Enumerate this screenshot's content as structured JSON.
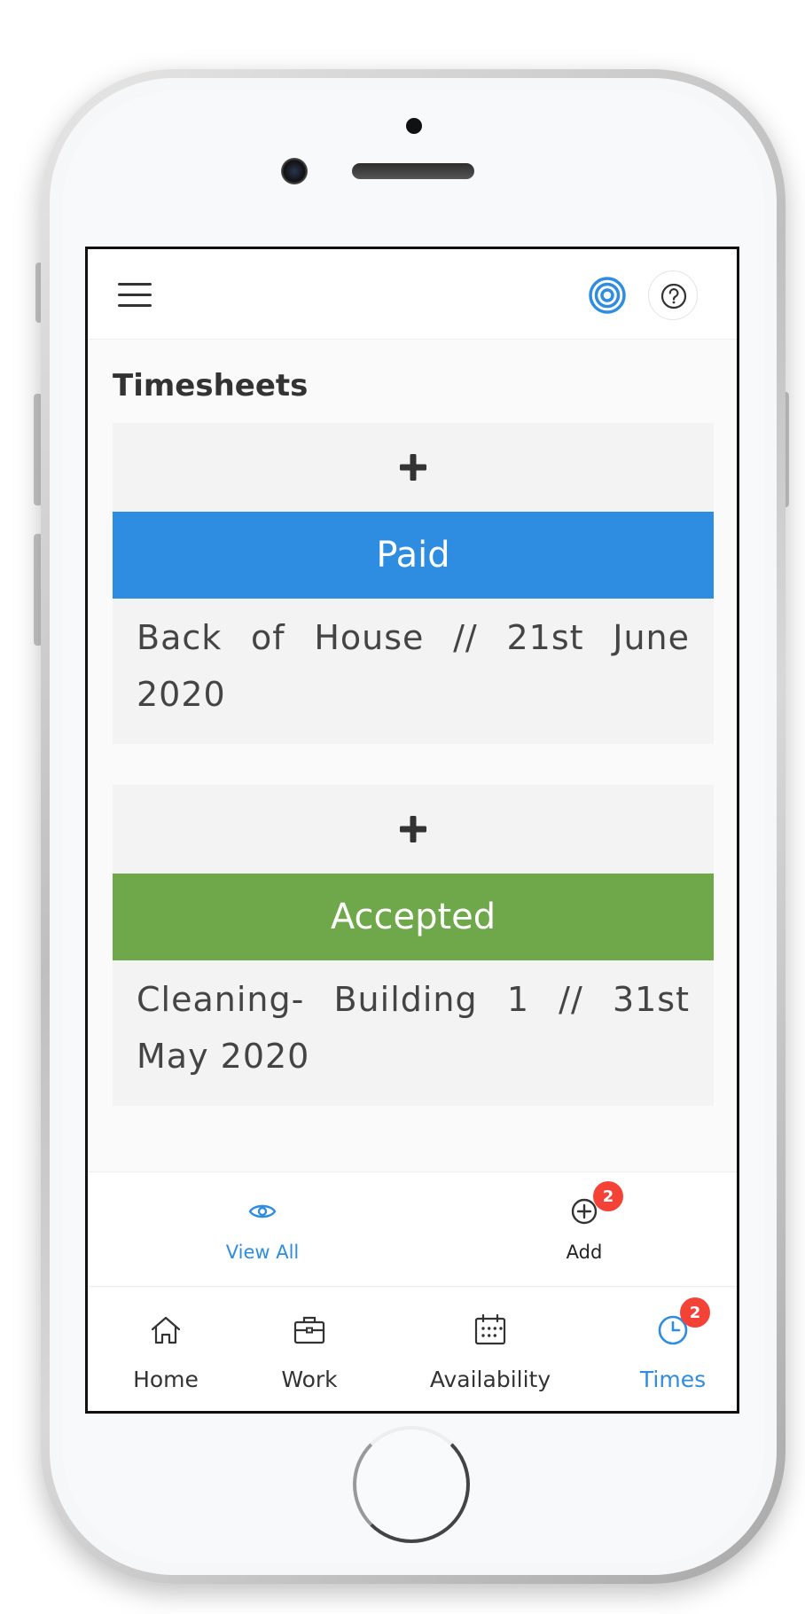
{
  "header": {
    "menu_icon": "hamburger-icon",
    "target_icon": "target-icon",
    "help_icon": "question-circle-icon",
    "accent": "#2e8de0"
  },
  "page": {
    "title": "Timesheets"
  },
  "timesheets": [
    {
      "add_icon": "plus-icon",
      "status": "Paid",
      "status_color": "#2e8de0",
      "description": "Back of House // 21st June 2020"
    },
    {
      "add_icon": "plus-icon",
      "status": "Accepted",
      "status_color": "#6fa84a",
      "description": "Cleaning- Building 1 // 31st May 2020"
    }
  ],
  "actions": {
    "view_all": {
      "label": "View All",
      "icon": "eye-icon",
      "color": "#2e8de0"
    },
    "add": {
      "label": "Add",
      "icon": "plus-circle-icon",
      "badge": "2"
    }
  },
  "bottom_nav": {
    "home": {
      "label": "Home",
      "icon": "home-icon"
    },
    "work": {
      "label": "Work",
      "icon": "briefcase-icon"
    },
    "availability": {
      "label": "Availability",
      "icon": "calendar-icon"
    },
    "times": {
      "label": "Times",
      "icon": "clock-icon",
      "badge": "2",
      "active": true,
      "active_color": "#2e8de0"
    }
  },
  "badge_color": "#f44336"
}
